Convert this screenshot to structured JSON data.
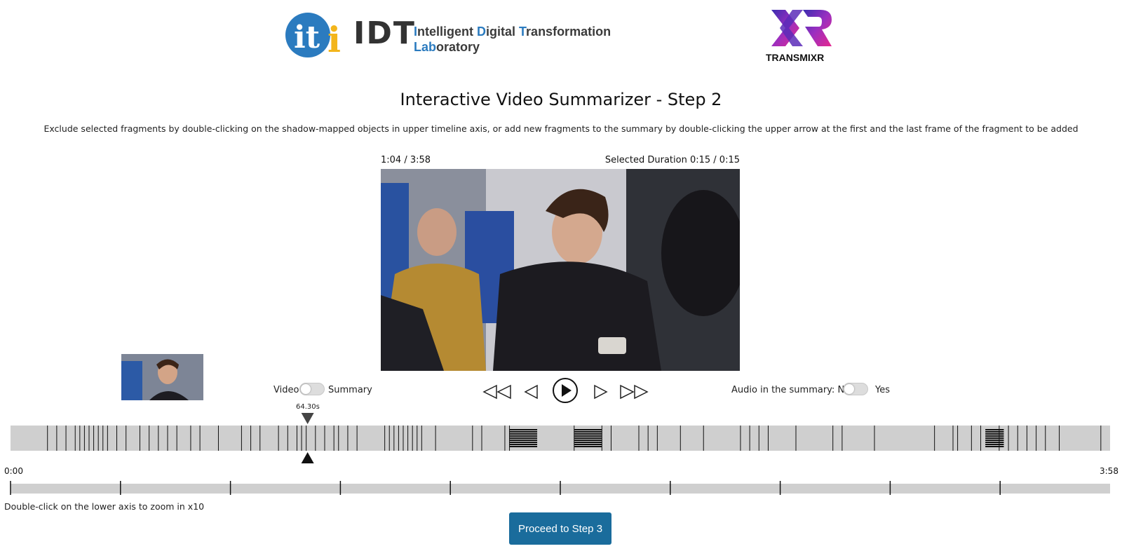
{
  "header": {
    "logo_idt": "IDT",
    "idt_line1_parts": [
      "I",
      "ntelligent ",
      "D",
      "igital ",
      "T",
      "ransformation"
    ],
    "idt_line2_parts": [
      "Lab",
      "oratory"
    ],
    "logo_transmixr": "TRANSMIXR"
  },
  "title": "Interactive Video Summarizer - Step 2",
  "instructions": "Exclude selected fragments by double-clicking on the shadow-mapped objects in upper timeline axis, or add new fragments to the summary by double-clicking the upper arrow at the first and the last frame of the fragment to be added",
  "player": {
    "time": "1:04 / 3:58",
    "selected_duration": "Selected Duration 0:15 / 0:15"
  },
  "toggles": {
    "video_label": "Video",
    "summary_label": "Summary",
    "audio_label": "Audio in the summary: No",
    "audio_yes": "Yes"
  },
  "controls": [
    "rewind-icon",
    "step-back-icon",
    "play-icon",
    "step-forward-icon",
    "fast-forward-icon"
  ],
  "timeline": {
    "playhead_label": "64.30s",
    "playhead_seconds": 64.3,
    "total_seconds": 238,
    "start_label": "0:00",
    "end_label": "3:58",
    "selected_fragments_seconds": [
      [
        108,
        114
      ],
      [
        122,
        128
      ],
      [
        211,
        215
      ]
    ],
    "shot_boundaries_seconds": [
      8,
      10,
      12,
      14,
      15,
      16,
      17,
      18,
      19,
      20,
      21,
      23,
      25,
      28,
      30,
      32,
      34,
      36,
      39,
      41,
      45,
      50,
      52,
      54,
      58,
      60,
      62,
      63,
      64,
      66,
      68,
      70,
      71,
      73,
      75,
      81,
      82,
      83,
      84,
      85,
      86,
      87,
      88,
      89,
      92,
      100,
      102,
      107,
      108,
      122,
      128,
      130,
      136,
      138,
      140,
      145,
      150,
      158,
      160,
      162,
      164,
      170,
      178,
      180,
      187,
      200,
      204,
      205,
      208,
      210,
      214,
      216,
      218,
      220,
      222,
      224,
      227,
      236
    ]
  },
  "zoom_hint": "Double-click on the lower axis to zoom in x10",
  "proceed_label": "Proceed to Step 3",
  "colors": {
    "button": "#1a6c9c",
    "axis": "#cfcfcf",
    "iti_blue": "#2b7bbf",
    "iti_yellow": "#f3b51b"
  }
}
